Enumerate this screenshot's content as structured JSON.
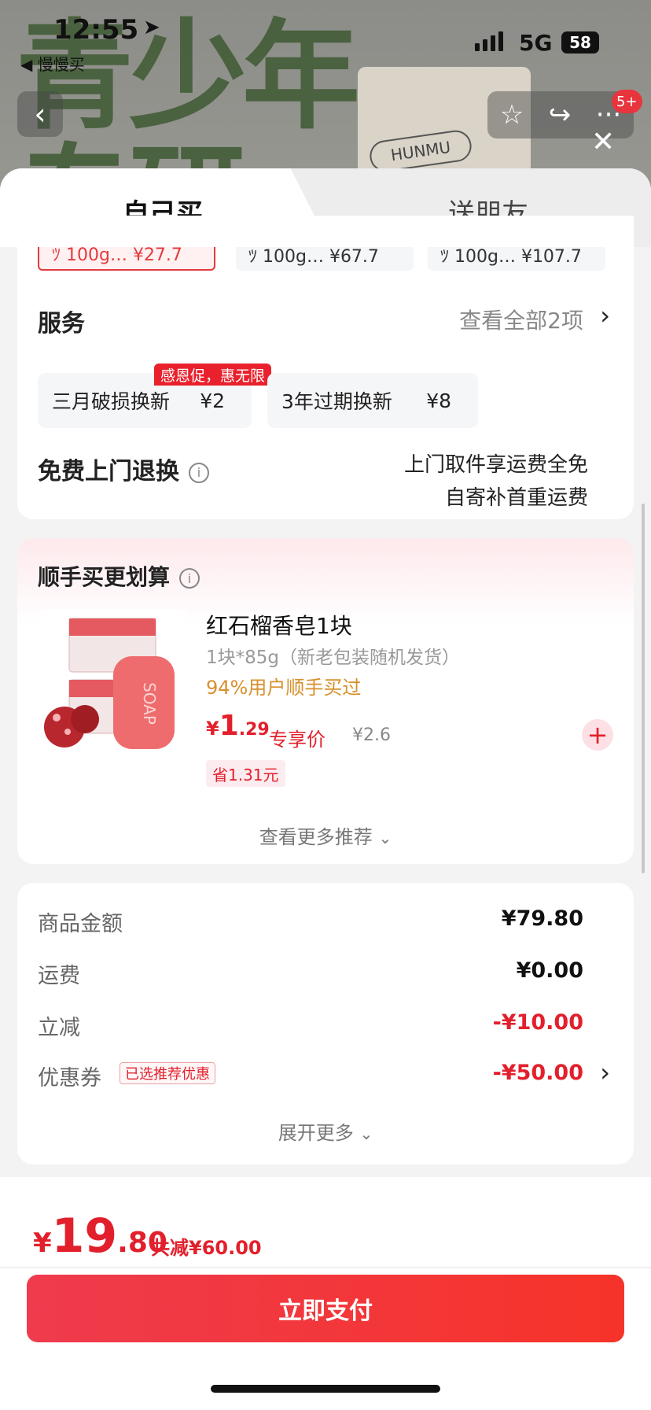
{
  "status_bar": {
    "time": "12:55",
    "back_app": "◀ 慢慢买",
    "network": "5G",
    "battery": "58"
  },
  "background": {
    "big_text": "青少年\n专研",
    "package_label": "HUNMU"
  },
  "top_actions": {
    "badge": "5+"
  },
  "tabs": [
    {
      "label": "自己买",
      "active": true
    },
    {
      "label": "送朋友",
      "active": false
    }
  ],
  "specs": [
    {
      "text": "ﾂ 100g… ¥27.7",
      "selected": true
    },
    {
      "text": "ﾂ 100g… ¥67.7",
      "selected": false
    },
    {
      "text": "ﾂ 100g… ¥107.7",
      "selected": false
    }
  ],
  "services": {
    "title": "服务",
    "view_all": "查看全部2项",
    "promo_tag": "感恩促，惠无限",
    "options": [
      {
        "name": "三月破损换新",
        "price": "¥2"
      },
      {
        "name": "3年过期换新",
        "price": "¥8"
      }
    ]
  },
  "returns": {
    "title": "免费上门退换",
    "line1": "上门取件享运费全免",
    "line2": "自寄补首重运费"
  },
  "recommend": {
    "title": "顺手买更划算",
    "product": {
      "name": "红石榴香皂1块",
      "spec": "1块*85g（新老包装随机发货）",
      "tag": "94%用户顺手买过",
      "price_currency": "¥",
      "price_int": "1",
      "price_dec": ".29",
      "exclusive": "专享价",
      "original": "¥2.6",
      "save": "省1.31元",
      "soap_label": "SOAP"
    },
    "more": "查看更多推荐"
  },
  "summary": {
    "rows": [
      {
        "label": "商品金额",
        "value": "¥79.80",
        "red": false
      },
      {
        "label": "运费",
        "value": "¥0.00",
        "red": false
      },
      {
        "label": "立减",
        "value": "-¥10.00",
        "red": true
      },
      {
        "label": "优惠券",
        "value": "-¥50.00",
        "red": true
      }
    ],
    "coupon_tag": "已选推荐优惠",
    "more": "展开更多"
  },
  "footer": {
    "total_currency": "¥",
    "total_int": "19",
    "total_dec": ".80",
    "total_save": "共减¥60.00",
    "pay_label": "立即支付"
  },
  "colors": {
    "accent": "#e2202c",
    "pay_start": "#ef3b4d",
    "pay_end": "#f6332a",
    "tag_orange": "#d7902c"
  },
  "icons": [
    "location-arrow-icon",
    "signal-icon",
    "battery-icon",
    "back-icon",
    "star-icon",
    "share-icon",
    "more-icon",
    "close-icon",
    "info-icon",
    "chevron-right-icon",
    "chevron-down-icon",
    "plus-icon"
  ]
}
